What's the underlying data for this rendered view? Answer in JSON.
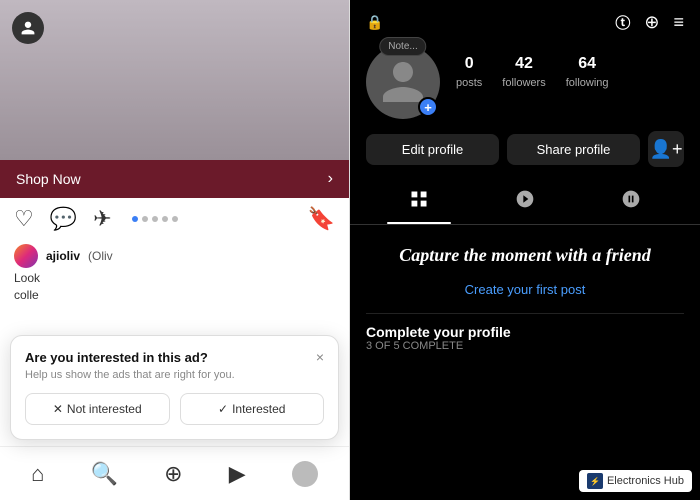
{
  "left": {
    "shop_now": "Shop Now",
    "post_user": "ajioliv",
    "post_user_full": "(Oliv",
    "post_text1": "Look",
    "post_text2": "colle",
    "ad_title": "Are you interested in this ad?",
    "ad_sub": "Help us show the ads that are right for you.",
    "btn_not_interested": "Not interested",
    "btn_interested": "Interested",
    "close_label": "×"
  },
  "right": {
    "note_placeholder": "Note...",
    "stats": {
      "posts_num": "0",
      "posts_label": "posts",
      "followers_num": "42",
      "followers_label": "followers",
      "following_num": "64",
      "following_label": "following"
    },
    "edit_profile": "Edit profile",
    "share_profile": "Share profile",
    "capture_text": "Capture the moment with a friend",
    "create_post": "Create your first post",
    "complete_title": "Complete your profile",
    "complete_sub": "3 OF 5 COMPLETE",
    "watermark": "Electronics Hub"
  }
}
